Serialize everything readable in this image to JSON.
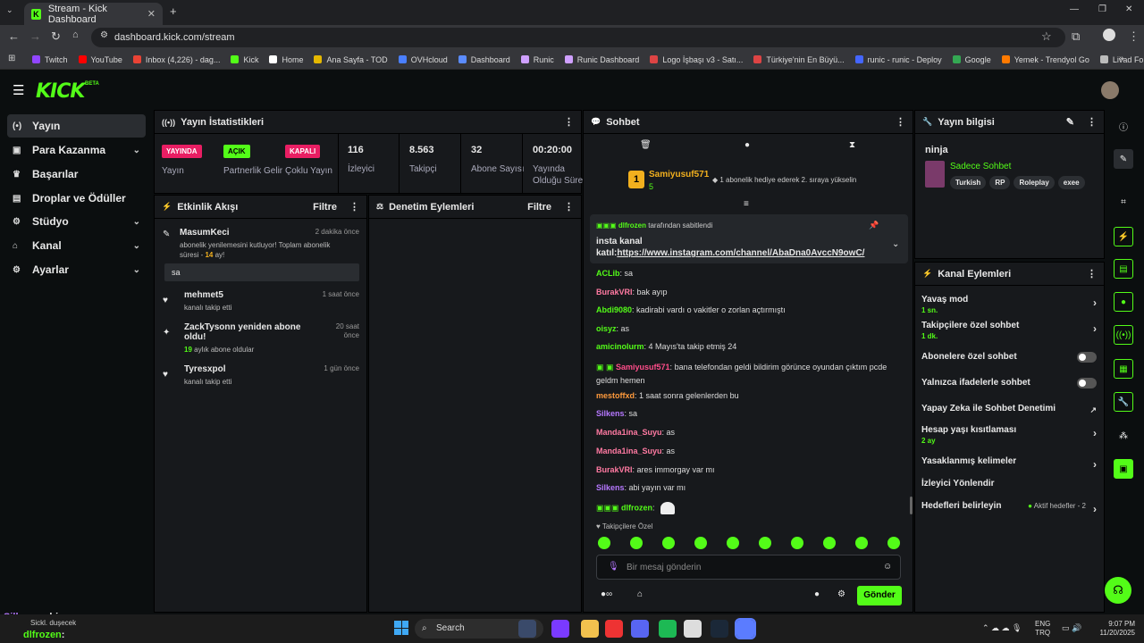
{
  "browser": {
    "tab_title": "Stream - Kick Dashboard",
    "url": "dashboard.kick.com/stream",
    "bookmarks": [
      "Twitch",
      "YouTube",
      "Inbox (4,226) - dag...",
      "Kick",
      "Home",
      "Ana Sayfa - TOD",
      "OVHcloud",
      "Dashboard",
      "Runic",
      "Runic Dashboard",
      "Logo İşbaşı v3 - Satı...",
      "Türkiye'nin En Büyü...",
      "runic - runic - Deploy",
      "Google",
      "Yemek - Trendyol Go",
      "Livad For Streamers"
    ]
  },
  "brand": {
    "logo": "KICK",
    "beta": "BETA"
  },
  "nav": [
    "Yayın",
    "Para Kazanma",
    "Başarılar",
    "Droplar ve Ödüller",
    "Stüdyo",
    "Kanal",
    "Ayarlar"
  ],
  "stats": {
    "title": "Yayın İstatistikleri",
    "status": [
      {
        "badge": "YAYINDA",
        "label": "Yayın"
      },
      {
        "badge": "AÇIK",
        "label": "Partnerlik Gelir"
      },
      {
        "badge": "KAPALI",
        "label": "Çoklu Yayın"
      }
    ],
    "numbers": [
      {
        "value": "116",
        "label": "İzleyici"
      },
      {
        "value": "8.563",
        "label": "Takipçi"
      },
      {
        "value": "32",
        "label": "Abone Sayısı"
      },
      {
        "value": "00:20:00",
        "label": "Yayında Olduğu Süre"
      }
    ]
  },
  "activity": {
    "title": "Etkinlik Akışı",
    "filter": "Filtre",
    "items": [
      {
        "name": "MasumKeci",
        "time": "2 dakika önce",
        "text": "abonelik yenilemesini kutluyor! Toplam abonelik süresi -",
        "months": "14",
        "unit": "ay!",
        "msg": "sa"
      },
      {
        "name": "mehmet5",
        "time": "1 saat önce",
        "text": "kanalı takip etti"
      },
      {
        "name": "ZackTysonn yeniden abone oldu!",
        "time": "20 saat önce",
        "months": "19",
        "text": "aylık abone oldular"
      },
      {
        "name": "Tyresxpol",
        "time": "1 gün önce",
        "text": "kanalı takip etti"
      }
    ]
  },
  "moderation": {
    "title": "Denetim Eylemleri",
    "filter": "Filtre"
  },
  "chat": {
    "title": "Sohbet",
    "top_user": "Samiyusuf571",
    "top_rank": "1",
    "top_count": "5",
    "top_note": "1 abonelik hediye ederek 2. sıraya yükselin",
    "pinned": {
      "by": "dlfrozen",
      "by_suffix": "tarafından sabitlendi",
      "line1": "insta kanal",
      "prefix": "katıl:",
      "link": "https://www.instagram.com/channel/AbaDna0AvccN9owC/"
    },
    "messages": [
      {
        "user": "ACLib",
        "color": "#53fc18",
        "text": "sa"
      },
      {
        "user": "BurakVRI",
        "color": "#ff7aa2",
        "text": "bak ayıp"
      },
      {
        "user": "Abdi9080",
        "color": "#53fc18",
        "text": "kadirabi vardı o vakitler o zorlan açtırmıştı"
      },
      {
        "user": "oisyz",
        "color": "#53fc18",
        "text": "as"
      },
      {
        "user": "amicinolurm",
        "color": "#53fc18",
        "text": "4 Mayıs'ta takip etmiş 24"
      },
      {
        "user": "Samiyusuf571",
        "color": "#ff4d8a",
        "text": "bana telefondan geldi bildirim görünce oyundan çıktım pcde geldm hemen"
      },
      {
        "user": "mestoffxd",
        "color": "#ff9a3c",
        "text": "1 saat sonra gelenlerden bu"
      },
      {
        "user": "Silkens",
        "color": "#b678ff",
        "text": "sa"
      },
      {
        "user": "Manda1ina_Suyu",
        "color": "#ff7aa2",
        "text": "as"
      },
      {
        "user": "Manda1ina_Suyu",
        "color": "#ff7aa2",
        "text": "as"
      },
      {
        "user": "BurakVRI",
        "color": "#ff7aa2",
        "text": "ares immorgay var mı"
      },
      {
        "user": "Silkens",
        "color": "#b678ff",
        "text": "abi yayın var mı"
      },
      {
        "user": "dlfrozen",
        "color": "#53fc18",
        "text": ""
      }
    ],
    "emote_label": "Takipçilere Özel",
    "placeholder": "Bir mesaj gönderin",
    "send": "Gönder"
  },
  "info": {
    "title": "Yayın bilgisi",
    "stream_title": "ninja",
    "category": "Sadece Sohbet",
    "tags": [
      "Turkish",
      "RP",
      "Roleplay",
      "exee"
    ]
  },
  "actions": {
    "title": "Kanal Eylemleri",
    "items": [
      {
        "label": "Yavaş mod",
        "sub": "1 sn."
      },
      {
        "label": "Takipçilere özel sohbet",
        "sub": "1 dk."
      },
      {
        "label": "Abonelere özel sohbet"
      },
      {
        "label": "Yalnızca ifadelerle sohbet"
      },
      {
        "label": "Yapay Zeka ile Sohbet Denetimi"
      },
      {
        "label": "Hesap yaşı kısıtlaması",
        "sub": "2 ay"
      },
      {
        "label": "Yasaklanmış kelimeler"
      },
      {
        "label": "İzleyici Yönlendir"
      },
      {
        "label": "Hedefleri belirleyin",
        "extra": "Aktif hedefler - 2"
      }
    ]
  },
  "overlay": {
    "line1_user": "Silkens",
    "line1_text": ": abi yayın var mı",
    "line2": "Sickl. duşecek",
    "line3_user": "dlfrozen",
    "line3_text": ":"
  },
  "taskbar": {
    "search": "Search",
    "lang1": "ENG",
    "lang2": "TRQ",
    "time": "9:07 PM",
    "date": "11/20/2025"
  },
  "colors": {
    "accent": "#53fc18",
    "live": "#e91e63",
    "panel": "#17191c"
  }
}
